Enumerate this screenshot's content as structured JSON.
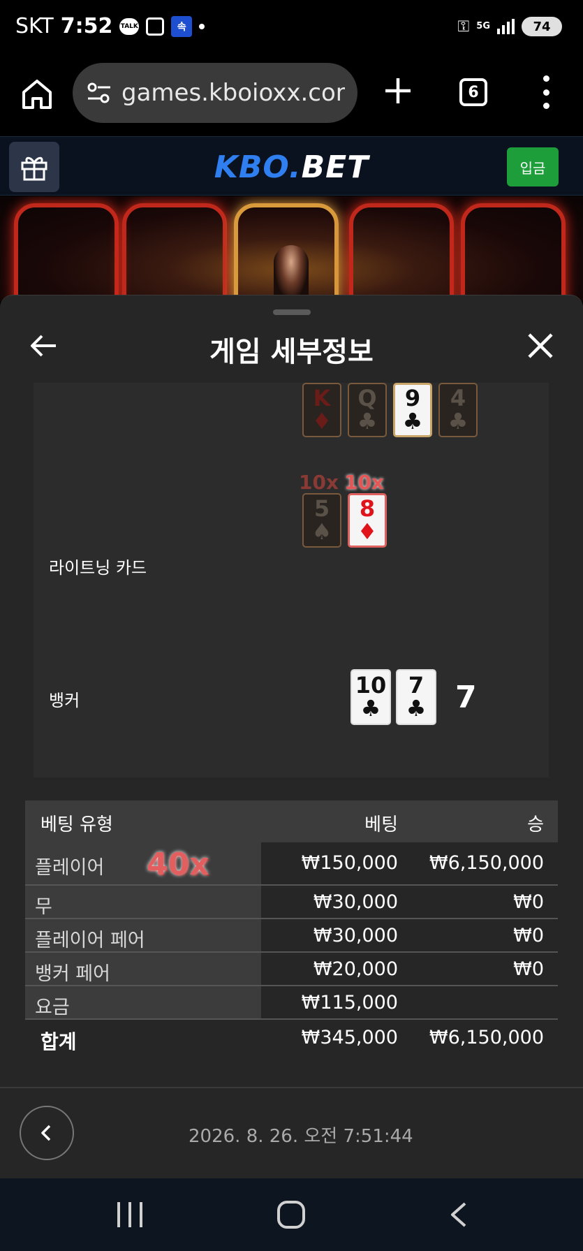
{
  "status_bar": {
    "carrier": "SKT",
    "time": "7:52",
    "talk_icon": "kakao-talk-icon",
    "battery": "74",
    "network": "5G"
  },
  "browser": {
    "url": "games.kboioxx.com/",
    "tab_count": "6"
  },
  "site": {
    "logo_part1": "KBO.",
    "logo_part2": "BET",
    "deposit_label": "입금"
  },
  "sheet": {
    "title": "게임 세부정보",
    "lightning_label": "라이트닝 카드",
    "banker_label": "뱅커",
    "lightning_cards_top": [
      {
        "rank": "K",
        "suit": "♦",
        "color": "red",
        "lit": false
      },
      {
        "rank": "Q",
        "suit": "♣",
        "color": "black",
        "lit": false
      },
      {
        "rank": "9",
        "suit": "♣",
        "color": "black",
        "lit": true
      },
      {
        "rank": "4",
        "suit": "♣",
        "color": "black",
        "lit": false
      }
    ],
    "lightning_mult_1": "10x",
    "lightning_mult_2": "10x",
    "lightning_cards_bottom": [
      {
        "rank": "5",
        "suit": "♠",
        "color": "black",
        "lit": false
      },
      {
        "rank": "8",
        "suit": "♦",
        "color": "red",
        "lit": true
      }
    ],
    "banker_cards": [
      {
        "rank": "10",
        "suit": "♣"
      },
      {
        "rank": "7",
        "suit": "♣"
      }
    ],
    "banker_score": "7"
  },
  "bets": {
    "headers": {
      "type": "베팅 유형",
      "bet": "베팅",
      "win": "승"
    },
    "rows": [
      {
        "name": "플레이어",
        "bet": "₩150,000",
        "win": "₩6,150,000",
        "mult": "40x"
      },
      {
        "name": "무",
        "bet": "₩30,000",
        "win": "₩0"
      },
      {
        "name": "플레이어 페어",
        "bet": "₩30,000",
        "win": "₩0"
      },
      {
        "name": "뱅커 페어",
        "bet": "₩20,000",
        "win": "₩0"
      },
      {
        "name": "요금",
        "bet": "₩115,000",
        "win": ""
      }
    ],
    "total": {
      "name": "합계",
      "bet": "₩345,000",
      "win": "₩6,150,000"
    }
  },
  "footer": {
    "timestamp": "2026. 8. 26. 오전 7:51:44"
  },
  "colors": {
    "logo_blue": "#2f7ff0",
    "deposit_green": "#1d9e3a",
    "multiplier_red": "#e35757",
    "sheet_bg": "#262626"
  }
}
